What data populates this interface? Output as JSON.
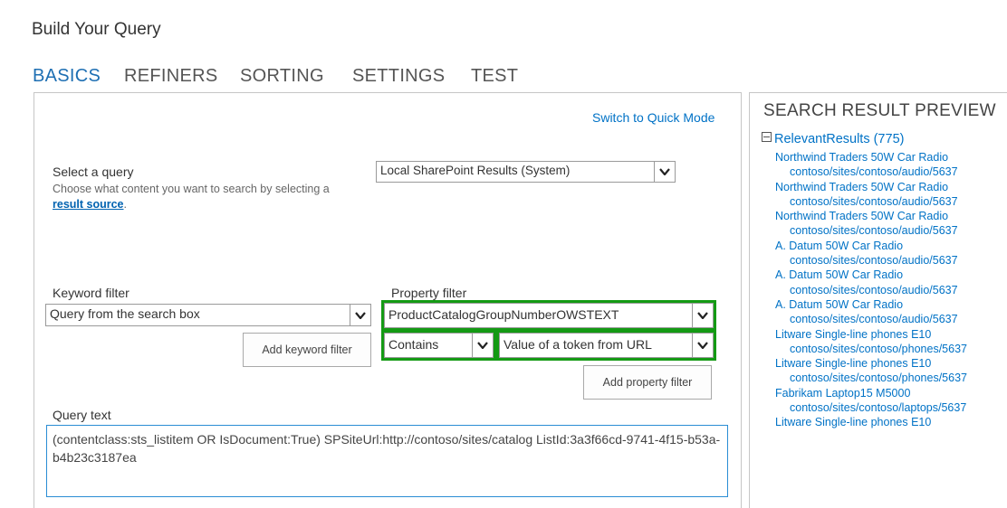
{
  "dialog": {
    "title": "Build Your Query"
  },
  "tabs": [
    {
      "label": "BASICS",
      "active": true
    },
    {
      "label": "REFINERS"
    },
    {
      "label": "SORTING"
    },
    {
      "label": "SETTINGS"
    },
    {
      "label": "TEST"
    }
  ],
  "basics": {
    "switch_mode_link": "Switch to Quick Mode",
    "select_query": {
      "label": "Select a query",
      "description_prefix": "Choose what content you want to search by selecting a ",
      "description_link": "result source",
      "description_suffix": ".",
      "value": "Local SharePoint Results (System)"
    },
    "keyword_filter": {
      "label": "Keyword filter",
      "value": "Query from the search box",
      "add_button": "Add keyword filter"
    },
    "property_filter": {
      "label": "Property filter",
      "property_value": "ProductCatalogGroupNumberOWSTEXT",
      "operator_value": "Contains",
      "value_source": "Value of a token from URL",
      "add_button": "Add property filter"
    },
    "query_text": {
      "label": "Query text",
      "value": "(contentclass:sts_listitem OR IsDocument:True) SPSiteUrl:http://contoso/sites/catalog ListId:3a3f66cd-9741-4f15-b53a-b4b23c3187ea"
    }
  },
  "preview": {
    "header": "SEARCH RESULT PREVIEW",
    "group_label": "RelevantResults (775)",
    "results": [
      {
        "title": "Northwind Traders 50W Car Radio",
        "url": "contoso/sites/contoso/audio/5637"
      },
      {
        "title": "Northwind Traders 50W Car Radio",
        "url": "contoso/sites/contoso/audio/5637"
      },
      {
        "title": "Northwind Traders 50W Car Radio",
        "url": "contoso/sites/contoso/audio/5637"
      },
      {
        "title": "A. Datum 50W Car Radio",
        "url": "contoso/sites/contoso/audio/5637"
      },
      {
        "title": "A. Datum 50W Car Radio",
        "url": "contoso/sites/contoso/audio/5637"
      },
      {
        "title": "A. Datum 50W Car Radio",
        "url": "contoso/sites/contoso/audio/5637"
      },
      {
        "title": "Litware Single-line phones E10",
        "url": "contoso/sites/contoso/phones/5637"
      },
      {
        "title": "Litware Single-line phones E10",
        "url": "contoso/sites/contoso/phones/5637"
      },
      {
        "title": "Fabrikam Laptop15 M5000",
        "url": "contoso/sites/contoso/laptops/5637"
      },
      {
        "title": "Litware Single-line phones E10",
        "url": ""
      }
    ]
  },
  "colors": {
    "accent": "#1e6fb3",
    "link": "#0072c6",
    "highlight": "#149a14"
  }
}
